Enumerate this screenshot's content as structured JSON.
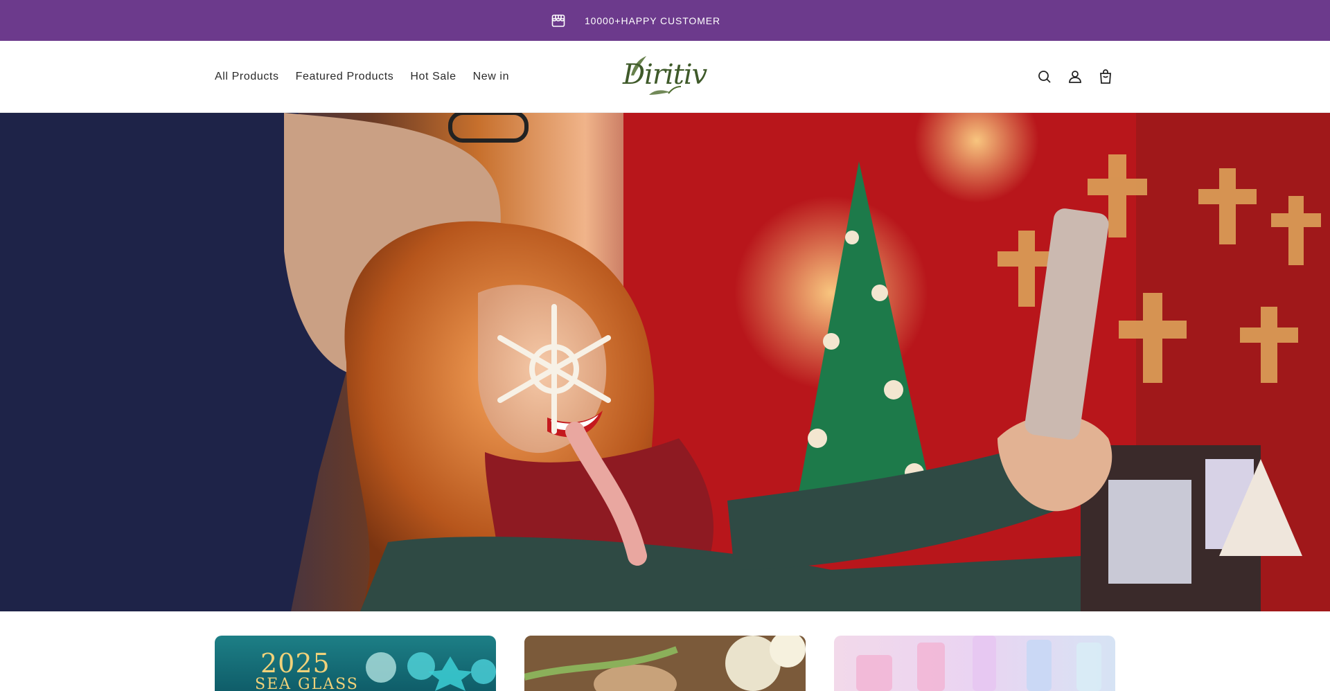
{
  "announcement": {
    "text": "10000+HAPPY CUSTOMER",
    "icon": "store-icon",
    "background": "#6c3a8c"
  },
  "header": {
    "nav": [
      {
        "label": "All Products"
      },
      {
        "label": "Featured Products"
      },
      {
        "label": "Hot Sale"
      },
      {
        "label": "New in"
      }
    ],
    "logo_text": "Diritiv",
    "icons": [
      "search-icon",
      "account-icon",
      "cart-icon"
    ]
  },
  "hero": {
    "image": "couple taking selfie at christmas market with ornament"
  },
  "products": {
    "cards": [
      {
        "text_year": "2025",
        "text_sub": "SEA GLASS"
      },
      {},
      {}
    ]
  },
  "colors": {
    "accent": "#6c3a8c",
    "logo": "#3f5a2a"
  }
}
